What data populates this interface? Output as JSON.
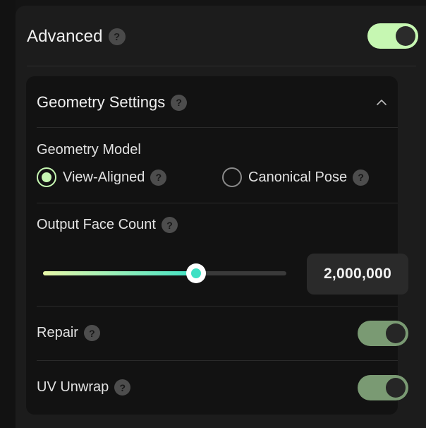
{
  "advanced": {
    "title": "Advanced",
    "help": "?",
    "enabled": true
  },
  "geometry": {
    "title": "Geometry Settings",
    "help": "?",
    "expanded": true,
    "model": {
      "label": "Geometry Model",
      "options": [
        {
          "label": "View-Aligned",
          "help": "?",
          "selected": true
        },
        {
          "label": "Canonical Pose",
          "help": "?",
          "selected": false
        }
      ]
    },
    "face_count": {
      "label": "Output Face Count",
      "help": "?",
      "value_text": "2,000,000",
      "slider_fraction": 0.63
    },
    "repair": {
      "label": "Repair",
      "help": "?",
      "enabled": true
    },
    "uv_unwrap": {
      "label": "UV Unwrap",
      "help": "?",
      "enabled": true
    }
  },
  "colors": {
    "accent": "#c6f7b2",
    "toggle_on_dim": "#7a9a73",
    "slider_end": "#3ee0c4"
  },
  "icons": {
    "help": "question-circle-icon",
    "collapse": "chevron-up-icon"
  }
}
